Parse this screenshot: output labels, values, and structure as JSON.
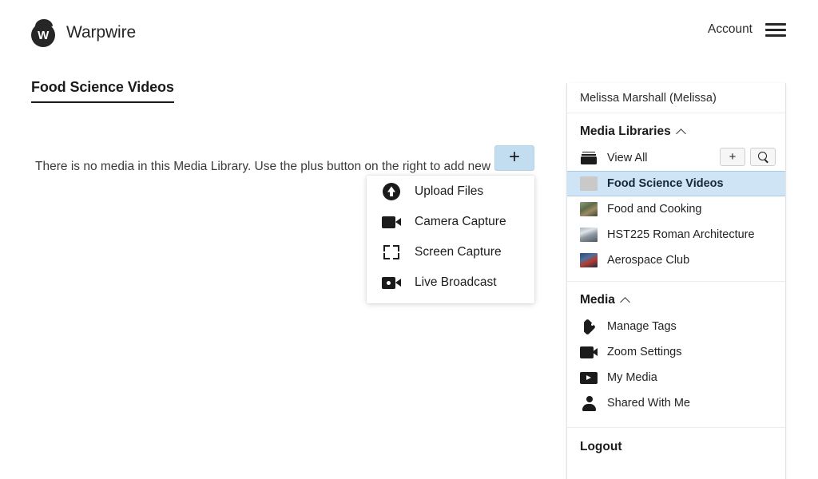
{
  "header": {
    "brand_name": "Warpwire",
    "logo_letter": "W",
    "account_label": "Account"
  },
  "main": {
    "page_title": "Food Science Videos",
    "add_button_label": "+",
    "empty_message": "There is no media in this Media Library. Use the plus button on the right to add new media."
  },
  "add_menu": {
    "items": [
      {
        "label": "Upload Files",
        "icon": "upload-icon"
      },
      {
        "label": "Camera Capture",
        "icon": "camera-icon"
      },
      {
        "label": "Screen Capture",
        "icon": "screen-capture-icon"
      },
      {
        "label": "Live Broadcast",
        "icon": "live-broadcast-icon"
      }
    ]
  },
  "sidebar": {
    "user": "Melissa Marshall (Melissa)",
    "media_libraries": {
      "title": "Media Libraries",
      "collapse_icon": "chevron-up-icon",
      "add_button_label": "+",
      "search_icon": "search-icon",
      "view_all_label": "View All",
      "items": [
        {
          "label": "Food Science Videos",
          "active": true,
          "thumb": "placeholder"
        },
        {
          "label": "Food and Cooking",
          "active": false,
          "thumb": "food"
        },
        {
          "label": "HST225 Roman Architecture",
          "active": false,
          "thumb": "roman"
        },
        {
          "label": "Aerospace Club",
          "active": false,
          "thumb": "aero"
        }
      ]
    },
    "media": {
      "title": "Media",
      "collapse_icon": "chevron-up-icon",
      "items": [
        {
          "label": "Manage Tags",
          "icon": "tag-icon"
        },
        {
          "label": "Zoom Settings",
          "icon": "camera-icon"
        },
        {
          "label": "My Media",
          "icon": "play-icon"
        },
        {
          "label": "Shared With Me",
          "icon": "person-icon"
        }
      ]
    },
    "logout_label": "Logout"
  },
  "colors": {
    "accent_blue": "#c2dcf0",
    "active_row": "#cfe4f5",
    "text_dark": "#1b1b1b"
  }
}
